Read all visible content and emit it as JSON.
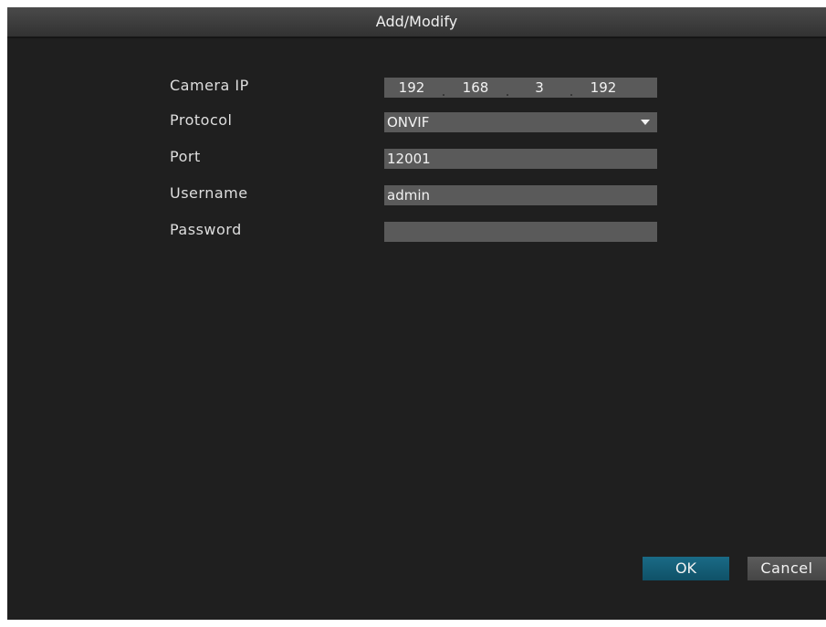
{
  "dialog": {
    "title": "Add/Modify"
  },
  "form": {
    "camera_ip": {
      "label": "Camera IP",
      "octets": [
        "192",
        "168",
        "3",
        "192"
      ],
      "separator": "."
    },
    "protocol": {
      "label": "Protocol",
      "value": "ONVIF",
      "icon": "chevron-down-icon"
    },
    "port": {
      "label": "Port",
      "value": "12001"
    },
    "username": {
      "label": "Username",
      "value": "admin"
    },
    "password": {
      "label": "Password",
      "value": ""
    }
  },
  "buttons": {
    "ok_label": "OK",
    "cancel_label": "Cancel"
  },
  "colors": {
    "background": "#1f1f1f",
    "field": "#5a5a5a",
    "ok_button": "#1a6b86",
    "cancel_button": "#505050",
    "text": "#f2f2f2"
  }
}
